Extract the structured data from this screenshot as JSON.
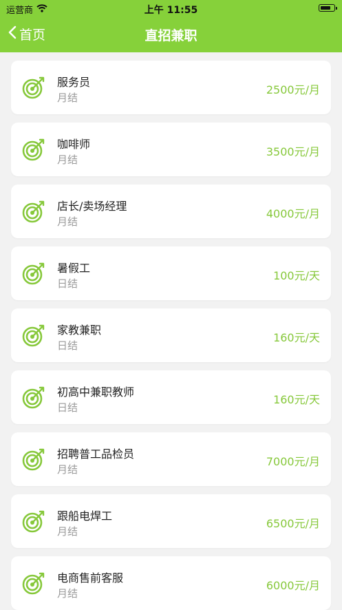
{
  "status": {
    "carrier": "运营商",
    "time": "上午 11:55",
    "battery_level": 0.8
  },
  "nav": {
    "back_label": "首页",
    "title": "直招兼职"
  },
  "colors": {
    "accent": "#86d13a",
    "salary": "#86c83a"
  },
  "jobs": [
    {
      "name": "服务员",
      "settle": "月结",
      "salary": "2500元/月",
      "icon": "target-icon"
    },
    {
      "name": "咖啡师",
      "settle": "月结",
      "salary": "3500元/月",
      "icon": "target-icon"
    },
    {
      "name": "店长/卖场经理",
      "settle": "月结",
      "salary": "4000元/月",
      "icon": "target-icon"
    },
    {
      "name": "暑假工",
      "settle": "日结",
      "salary": "100元/天",
      "icon": "target-icon"
    },
    {
      "name": "家教兼职",
      "settle": "日结",
      "salary": "160元/天",
      "icon": "target-icon"
    },
    {
      "name": "初高中兼职教师",
      "settle": "日结",
      "salary": "160元/天",
      "icon": "target-icon"
    },
    {
      "name": "招聘普工品检员",
      "settle": "月结",
      "salary": "7000元/月",
      "icon": "target-icon"
    },
    {
      "name": "跟船电焊工",
      "settle": "月结",
      "salary": "6500元/月",
      "icon": "target-icon"
    },
    {
      "name": "电商售前客服",
      "settle": "月结",
      "salary": "6000元/月",
      "icon": "target-icon"
    }
  ]
}
